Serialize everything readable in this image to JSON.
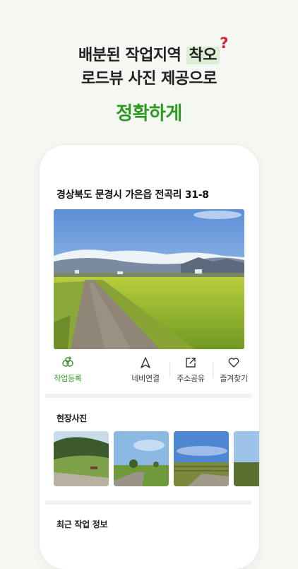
{
  "headline": {
    "line1_prefix": "배분된 작업지역 ",
    "line1_highlight": "착오",
    "question_mark": "?",
    "line2": "로드뷰 사진 제공으로",
    "accent": "정확하게"
  },
  "detail": {
    "address": "경상북도 문경시 가은읍 전곡리 31-8",
    "actions": [
      {
        "label": "작업등록",
        "icon": "plant-icon"
      },
      {
        "label": "네비연결",
        "icon": "navigation-arrow-icon"
      },
      {
        "label": "주소공유",
        "icon": "share-icon"
      },
      {
        "label": "즐겨찾기",
        "icon": "heart-icon"
      }
    ],
    "field_photos_title": "현장사진",
    "recent_work_title": "최근 작업 정보"
  },
  "colors": {
    "accent_green": "#2e9a22",
    "highlight_bg": "#dcefd4",
    "question_red": "#e0212b"
  }
}
